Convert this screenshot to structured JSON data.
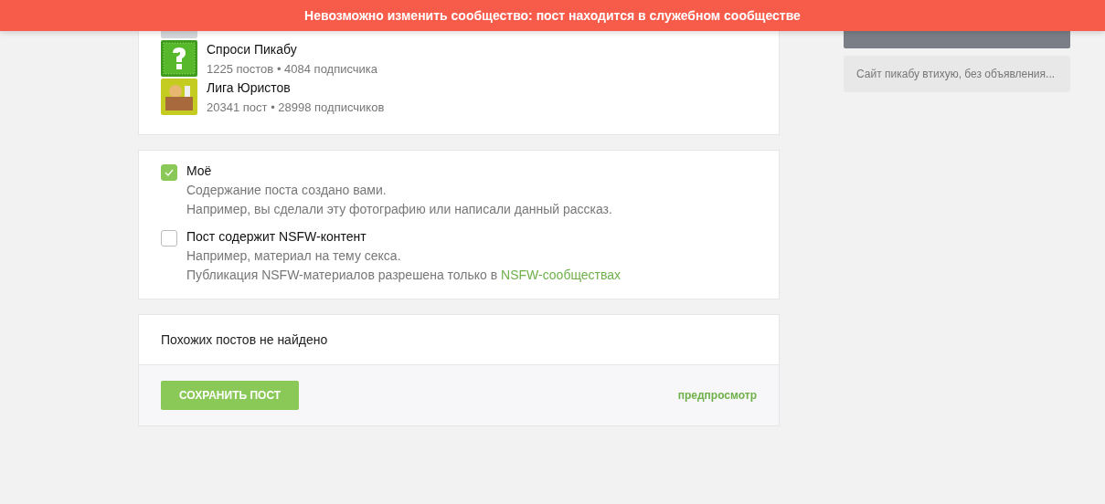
{
  "alert": {
    "text": "Невозможно изменить сообщество: пост находится в служебном сообществе"
  },
  "communities": [
    {
      "kind": "hidden"
    },
    {
      "kind": "question",
      "name": "Спроси Пикабу",
      "posts": "1225 постов",
      "separator": "•",
      "subscribers": "4084 подписчика"
    },
    {
      "kind": "desk",
      "name": "Лига Юристов",
      "posts": "20341 пост",
      "separator": "•",
      "subscribers": "28998 подписчиков"
    }
  ],
  "options": [
    {
      "label": "Моё",
      "checked": true,
      "lines": [
        "Содержание поста создано вами.",
        "Например, вы сделали эту фотографию или написали данный рассказ."
      ]
    },
    {
      "label": "Пост содержит NSFW-контент",
      "checked": false,
      "lines": [
        "Например, материал на тему секса.",
        "Публикация NSFW-материалов разрешена только в"
      ],
      "link": "NSFW-сообществах"
    }
  ],
  "similar": {
    "text": "Похожих постов не найдено"
  },
  "save_button": "СОХРАНИТЬ ПОСТ",
  "preview_link": "предпросмотр",
  "sidebar": {
    "caption": "Сайт пикабу втихую, без объявления..."
  }
}
